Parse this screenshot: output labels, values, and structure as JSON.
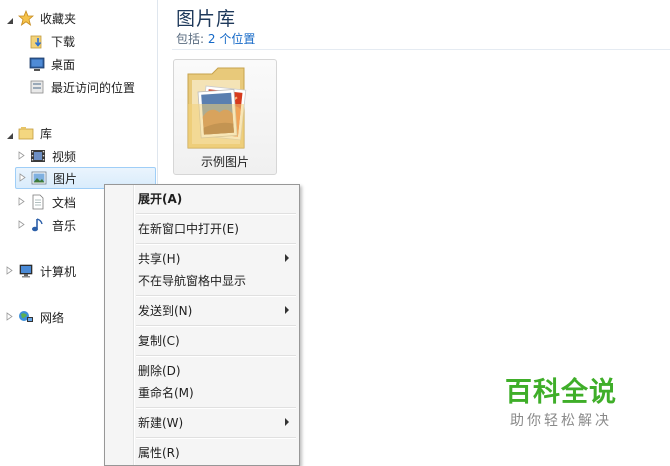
{
  "nav": {
    "favorites": {
      "label": "收藏夹",
      "items": [
        "下载",
        "桌面",
        "最近访问的位置"
      ]
    },
    "libraries": {
      "label": "库",
      "items": [
        "视频",
        "图片",
        "文档",
        "音乐"
      ]
    },
    "computer": {
      "label": "计算机"
    },
    "network": {
      "label": "网络"
    }
  },
  "main": {
    "title": "图片库",
    "includes_label": "包括:",
    "includes_link": "2 个位置",
    "folder": {
      "label": "示例图片"
    }
  },
  "context_menu": {
    "expand": "展开(A)",
    "open_new_window": "在新窗口中打开(E)",
    "share": "共享(H)",
    "hide_in_nav": "不在导航窗格中显示",
    "send_to": "发送到(N)",
    "copy": "复制(C)",
    "delete": "删除(D)",
    "rename": "重命名(M)",
    "new": "新建(W)",
    "properties": "属性(R)"
  },
  "watermark": {
    "line1": "百科全说",
    "line2": "助你轻松解决"
  }
}
